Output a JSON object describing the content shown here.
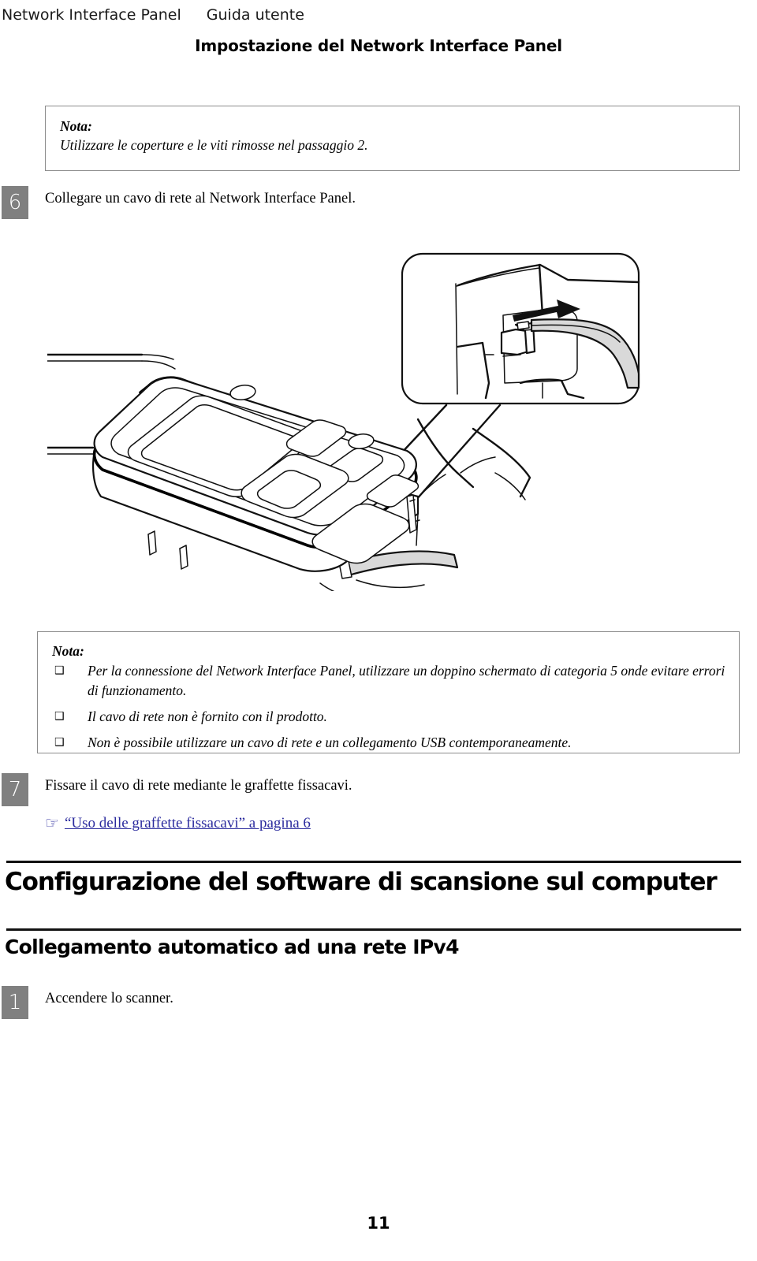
{
  "header": {
    "document_title": "Network Interface Panel",
    "guide_label": "Guida utente"
  },
  "section_title": "Impostazione del Network Interface Panel",
  "note_top": {
    "label": "Nota:",
    "text": "Utilizzare le coperture e le viti rimosse nel passaggio 2."
  },
  "steps": {
    "step6": {
      "number": "6",
      "text": "Collegare un cavo di rete al Network Interface Panel."
    },
    "step7": {
      "number": "7",
      "text": "Fissare il cavo di rete mediante le graffette fissacavi."
    },
    "step1b": {
      "number": "1",
      "text": "Accendere lo scanner."
    }
  },
  "figure": {
    "alt": "Illustrazione: collegamento del cavo di rete al Network Interface Panel, con ingrandimento del connettore RJ-45",
    "callout_label": "dettaglio-connettore-rj45"
  },
  "note_bottom": {
    "label": "Nota:",
    "bullet_glyph": "❑",
    "items": [
      "Per la connessione del Network Interface Panel, utilizzare un doppino schermato di categoria 5 onde evitare errori di funzionamento.",
      "Il cavo di rete non è fornito con il prodotto.",
      "Non è possibile utilizzare un cavo di rete e un collegamento USB contemporaneamente."
    ]
  },
  "xref": {
    "icon": "☞",
    "text": "“Uso delle graffette fissacavi” a pagina 6",
    "color": "#2b2b9e"
  },
  "headings": {
    "h1": "Configurazione del software di scansione sul computer",
    "h2": "Collegamento automatico ad una rete IPv4"
  },
  "page_number": "11",
  "colors": {
    "step_badge_bg": "#808080",
    "note_border": "#8c8c8c",
    "link": "#2b2b9e",
    "rule": "#111111",
    "cable_fill": "#d9d9d9"
  }
}
